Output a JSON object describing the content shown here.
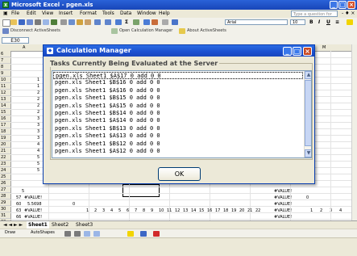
{
  "excel": {
    "title": "Microsoft Excel - pgen.xls",
    "menu": [
      "File",
      "Edit",
      "View",
      "Insert",
      "Format",
      "Tools",
      "Data",
      "Window",
      "Help"
    ],
    "help_placeholder": "Type a question for help",
    "font_name": "Arial",
    "font_size": "10",
    "reviewing_toolbar": [
      "Disconnect ActiveSheets",
      "Open Calculation Manager",
      "About ActiveSheets"
    ],
    "name_box": "E30",
    "columns": [
      "A",
      "M"
    ],
    "rows": [
      "6",
      "7",
      "8",
      "9",
      "10",
      "11",
      "12",
      "13",
      "14",
      "15",
      "16",
      "17",
      "18",
      "19",
      "20",
      "21",
      "22",
      "23",
      "24",
      "25",
      "26",
      "27",
      "28",
      "29",
      "30",
      "31",
      "32"
    ],
    "row_cells": [
      {
        "r": 10,
        "a": "1"
      },
      {
        "r": 11,
        "a": "1"
      },
      {
        "r": 12,
        "a": "2"
      },
      {
        "r": 13,
        "a": "2"
      },
      {
        "r": 14,
        "a": "2"
      },
      {
        "r": 15,
        "a": "2"
      },
      {
        "r": 16,
        "a": "3"
      },
      {
        "r": 17,
        "a": "3"
      },
      {
        "r": 18,
        "a": "3"
      },
      {
        "r": 19,
        "a": "3"
      },
      {
        "r": 20,
        "a": "4"
      },
      {
        "r": 21,
        "a": "4"
      },
      {
        "r": 22,
        "a": "5"
      },
      {
        "r": 23,
        "a": "5"
      },
      {
        "r": 24,
        "a": "5"
      }
    ],
    "bottom_cells": {
      "r25": [
        "5",
        "#VALUE!"
      ],
      "r26": [
        "57",
        "#VALUE!",
        "#VALUE!",
        "0"
      ],
      "r27": [
        "60",
        "5.5698",
        "0",
        "#VALUE!"
      ],
      "r28": [
        "63",
        "#VALUE!",
        "#VALUE!",
        "1",
        "2",
        "3",
        "4"
      ],
      "r29": [
        "66",
        "#VALUE!",
        "#VALUE!"
      ]
    },
    "axis_ticks": [
      "1",
      "2",
      "3",
      "4",
      "5",
      "6",
      "7",
      "8",
      "9",
      "10",
      "11",
      "12",
      "13",
      "14",
      "15",
      "16",
      "17",
      "18",
      "19",
      "20",
      "21",
      "22"
    ],
    "sheet_tabs": [
      "Sheet1",
      "Sheet2",
      "Sheet3"
    ],
    "draw_label": "Draw",
    "autoshapes_label": "AutoShapes"
  },
  "dialog": {
    "title": "Calculation Manager",
    "group_label": "Tasks Currently Being Evaluated at the Server",
    "tasks": [
      "pgen.xls Sheet1 $A$17 0 add 0 0",
      "pgen.xls Sheet1 $B$16 0 add 0 0",
      "pgen.xls Sheet1 $A$16 0 add 0 0",
      "pgen.xls Sheet1 $B$15 0 add 0 0",
      "pgen.xls Sheet1 $A$15 0 add 0 0",
      "pgen.xls Sheet1 $B$14 0 add 0 0",
      "pgen.xls Sheet1 $A$14 0 add 0 0",
      "pgen.xls Sheet1 $B$13 0 add 0 0",
      "pgen.xls Sheet1 $A$13 0 add 0 0",
      "pgen.xls Sheet1 $B$12 0 add 0 0",
      "pgen.xls Sheet1 $A$12 0 add 0 0"
    ],
    "ok_label": "OK"
  },
  "colors": {
    "titlebar": "#2a62d8",
    "dialog_title": "#1b4fcf",
    "face": "#ece9d8"
  }
}
